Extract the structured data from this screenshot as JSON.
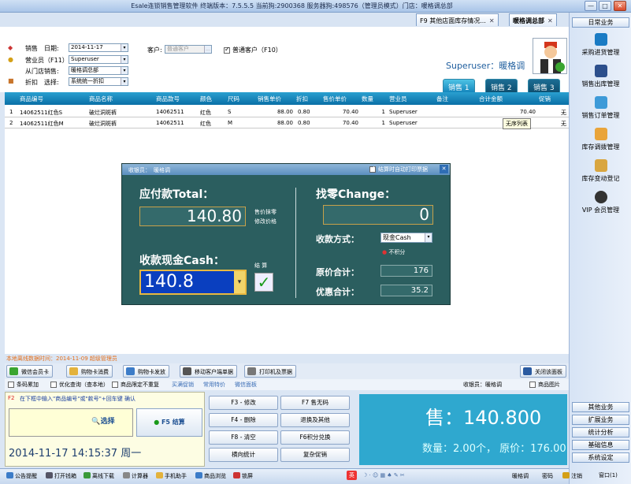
{
  "window": {
    "title": "Esale连锁销售管理软件 终端版本：7.5.5.5 当前狗:2900368 服务器狗:498576（管理员模式）门店：暖格调总部",
    "min": "—",
    "max": "□",
    "close": "✕"
  },
  "tabs": [
    {
      "label": "F9 其他店面库存情况..."
    },
    {
      "label": "暖格调总部"
    }
  ],
  "tab_close": "✕",
  "sidebar": {
    "header": "日常业务",
    "items": [
      "采购进货管理",
      "销售出库管理",
      "销售订单管理",
      "库存调拨管理",
      "库存变动登记",
      "VIP 会员管理"
    ],
    "bottom": [
      "其他业务",
      "扩展业务",
      "统计分析",
      "基础信息",
      "系统设定"
    ]
  },
  "form": {
    "sale_label": "销售",
    "date_label": "日期:",
    "date_value": "2014-11-17",
    "clerk_label": "营业员（F11）:",
    "clerk_value": "Superuser",
    "from_store_label": "从门店销售:",
    "from_store_value": "暖格调总部",
    "discount_label": "折扣",
    "select_label": "选择:",
    "discount_value": "系统统一折扣",
    "customer_label": "客户:",
    "customer_placeholder": "普通客户",
    "customer_more": "...",
    "normal_customer_label": "普通客户（F10）",
    "normal_customer_checked": true
  },
  "user": {
    "name": "Superuser：暖格调"
  },
  "sale_tabs": [
    "销售 1",
    "销售 2",
    "销售 3"
  ],
  "table": {
    "headers": [
      "商品编号",
      "商品名称",
      "商品款号",
      "颜色",
      "尺码",
      "销售单价",
      "折扣",
      "售价单价",
      "数量",
      "营业员",
      "备注",
      "合计金额",
      "促销"
    ],
    "rows": [
      {
        "num": "1",
        "code": "14062511红色S",
        "name": "破烂洞斑裤",
        "style": "14062511",
        "color": "红色",
        "size": "S",
        "price": "88.00",
        "discount": "0.80",
        "sale_price": "70.40",
        "qty": "1",
        "clerk": "Superuser",
        "note": "",
        "total": "70.40",
        "promo": "无"
      },
      {
        "num": "2",
        "code": "14062511红色M",
        "name": "破烂洞斑裤",
        "style": "14062511",
        "color": "红色",
        "size": "M",
        "price": "88.00",
        "discount": "0.80",
        "sale_price": "70.40",
        "qty": "1",
        "clerk": "Superuser",
        "note": "",
        "total": "",
        "promo": "无"
      }
    ],
    "tooltip": "无序列表"
  },
  "dialog": {
    "cashier_label": "收银员：",
    "cashier_value": "暖格调",
    "auto_print_label": "结算时自动打印票据",
    "auto_print_checked": true,
    "close": "✕",
    "payable_label": "应付款Total：",
    "payable_value": "140.80",
    "note1": "售价抹零",
    "note2": "修改价格",
    "cash_label": "收款现金Cash：",
    "cash_value": "140.8",
    "settle_label": "结  算",
    "settle_icon": "✓",
    "change_label": "找零Change：",
    "change_value": "0",
    "method_label": "收款方式：",
    "method_value": "现金Cash",
    "no_points": "不积分",
    "orig_label": "原价合计：",
    "orig_value": "176",
    "discount_label": "优惠合计：",
    "discount_value": "35.2"
  },
  "status_line": "本地离线数据时间：2014-11-09  超级管理员",
  "buttons": [
    "微信会员卡",
    "购物卡消费",
    "购物卡发放",
    "移动客户端单据",
    "打印机及票据",
    "关闭该面板"
  ],
  "options": {
    "barcode": "条码累加",
    "optimize": "优化查询（查本地）",
    "restrict": "商品限定不重复",
    "buy_promo": "买满促销",
    "common": "常用特价",
    "wechat": "微信面板",
    "cashier": "收银员：暖格调",
    "product_image": "商品图片"
  },
  "input_area": {
    "hint_key": "F2",
    "hint": "在下框中输入\"商品编号\"或\"款号\"+回车键 确认",
    "select_label": "选择",
    "confirm_label": "F5 结算",
    "datetime": "2014-11-17  14:15:37  周一"
  },
  "mid_buttons": [
    "F3 - 修改",
    "F7 售无码",
    "F4 - 删除",
    "退换及其他",
    "F8 - 清空",
    "F6积分兑换",
    "横向统计",
    "复杂促销"
  ],
  "display": {
    "sale_label": "售：",
    "sale_value": "140.800",
    "qty_label": "数量：",
    "qty_value": "2.00个",
    "orig_label": "原价：",
    "orig_value": "176.00"
  },
  "taskbar": {
    "items": [
      "公告提醒",
      "打开钱箱",
      "离线下载",
      "计算器",
      "手机助手",
      "商品浏览",
      "锁屏"
    ],
    "ime": "英",
    "user": "暖格调",
    "password": "密码",
    "logout": "注销",
    "window": "窗口(1)"
  },
  "colors": {
    "title_blue": "#1f5e9e",
    "grid_header": "#0a6fa6",
    "dialog_bg": "#2b5e5f",
    "display_bg": "#2fa8cf",
    "status_orange": "#e46f1b"
  }
}
